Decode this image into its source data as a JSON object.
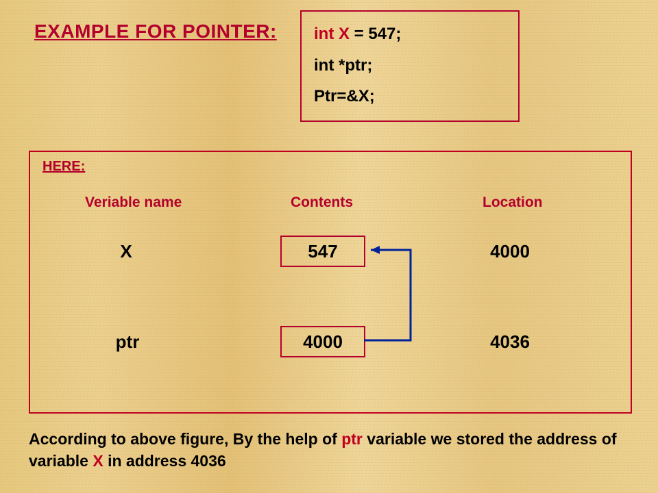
{
  "title": "EXAMPLE FOR POINTER:",
  "code": {
    "line1_red": "int X",
    "line1_rest": " = 547;",
    "line2": "int *ptr;",
    "line3": "Ptr=&X;"
  },
  "panel": {
    "here": "HERE:",
    "headers": {
      "var": "Veriable name",
      "contents": "Contents",
      "location": "Location"
    },
    "rows": [
      {
        "name": "X",
        "value": "547",
        "location": "4000"
      },
      {
        "name": "ptr",
        "value": "4000",
        "location": "4036"
      }
    ]
  },
  "caption": {
    "t1": "According to above figure, By the help of ",
    "ptr": "ptr",
    "t2": " variable we stored the address of variable ",
    "x": "X",
    "t3": " in address 4036"
  },
  "colors": {
    "accent": "#b3002d"
  }
}
